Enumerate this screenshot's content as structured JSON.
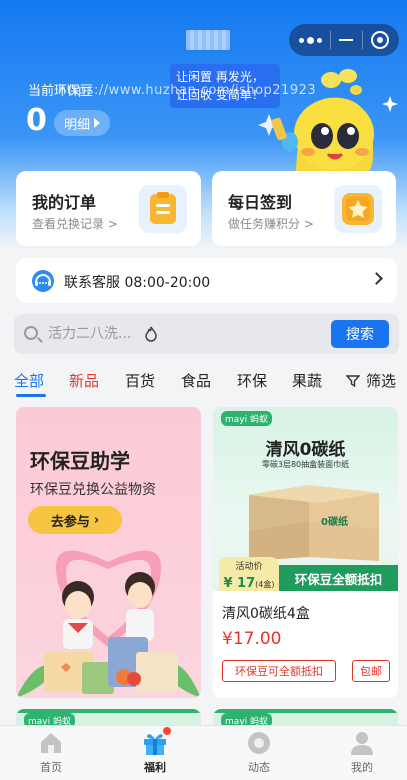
{
  "header": {
    "bean_label": "当前环保豆",
    "bean_count": "0",
    "detail_label": "明细",
    "slogan_line1": "让闲置 再发光，",
    "slogan_line2": "让回收 变简单！",
    "watermark": "https://www.huzhan.com/ishop21923"
  },
  "cards": {
    "order_title": "我的订单",
    "order_sub": "查看兑换记录 >",
    "sign_title": "每日签到",
    "sign_sub": "做任务赚积分 >"
  },
  "service": {
    "label": "联系客服 08:00-20:00"
  },
  "search": {
    "placeholder": "活力二八洗...",
    "button": "搜索"
  },
  "tabs": [
    "全部",
    "新品",
    "百货",
    "食品",
    "环保",
    "果蔬",
    "筛选"
  ],
  "promo": {
    "title": "环保豆助学",
    "subtitle": "环保豆兑换公益物资",
    "button": "去参与"
  },
  "product": {
    "brand": "mayi 蚂蚁",
    "image_title": "清风0碳纸",
    "image_subtitle": "零碳3层80抽盒装面巾纸",
    "price_badge_label": "活动价",
    "price_badge_value": "¥ 17",
    "price_badge_unit": "(4盒)",
    "offset_banner": "环保豆全额抵扣",
    "name": "清风0碳纸4盒",
    "price": "¥17.00",
    "tag_offset": "环保豆可全额抵扣",
    "tag_shipping": "包邮",
    "box_text": "0碳纸"
  },
  "peek_brand": "mayi 蚂蚁",
  "tabbar": [
    {
      "label": "首页"
    },
    {
      "label": "福利"
    },
    {
      "label": "动态"
    },
    {
      "label": "我的"
    }
  ],
  "colors": {
    "primary": "#1a73f0",
    "red": "#e0352a",
    "green": "#1f9b5d"
  }
}
